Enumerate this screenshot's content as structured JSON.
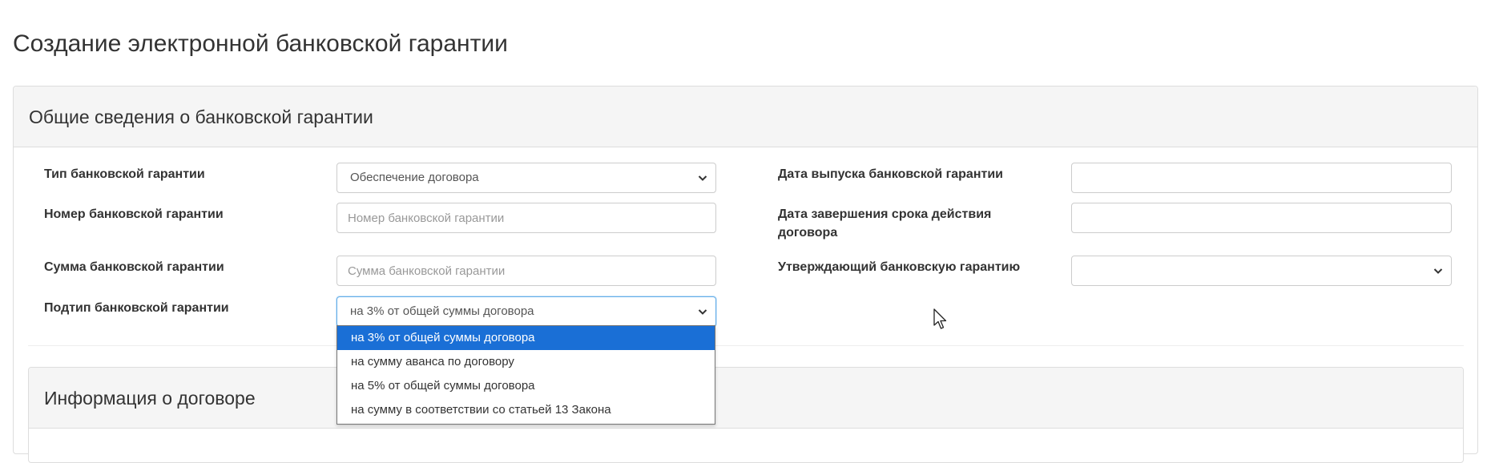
{
  "page": {
    "title": "Создание электронной банковской гарантии"
  },
  "general_panel": {
    "title": "Общие сведения о банковской гарантии",
    "fields": {
      "guarantee_type": {
        "label": "Тип банковской гарантии",
        "value": "Обеспечение договора"
      },
      "guarantee_number": {
        "label": "Номер банковской гарантии",
        "placeholder": "Номер банковской гарантии",
        "value": ""
      },
      "guarantee_amount": {
        "label": "Сумма банковской гарантии",
        "placeholder": "Сумма банковской гарантии",
        "value": ""
      },
      "guarantee_subtype": {
        "label": "Подтип банковской гарантии",
        "value": "на 3% от общей суммы договора",
        "options": [
          "на 3% от общей суммы договора",
          "на сумму аванса по договору",
          "на 5% от общей суммы договора",
          "на сумму в соответствии со статьей 13 Закона"
        ],
        "selected_index": 0
      },
      "issue_date": {
        "label": "Дата выпуска банковской гарантии",
        "value": ""
      },
      "contract_end_date": {
        "label": "Дата завершения срока действия договора",
        "value": ""
      },
      "approver": {
        "label": "Утверждающий банковскую гарантию",
        "value": ""
      }
    }
  },
  "contract_panel": {
    "title": "Информация о договоре"
  },
  "icons": {
    "select_arrow": "chevron-down-icon",
    "pointer": "mouse-cursor-icon"
  },
  "colors": {
    "panel_heading_bg": "#f5f5f5",
    "border": "#dddddd",
    "focus_border": "#66afe9",
    "option_selected_bg": "#1a6fd6",
    "text": "#333333"
  }
}
